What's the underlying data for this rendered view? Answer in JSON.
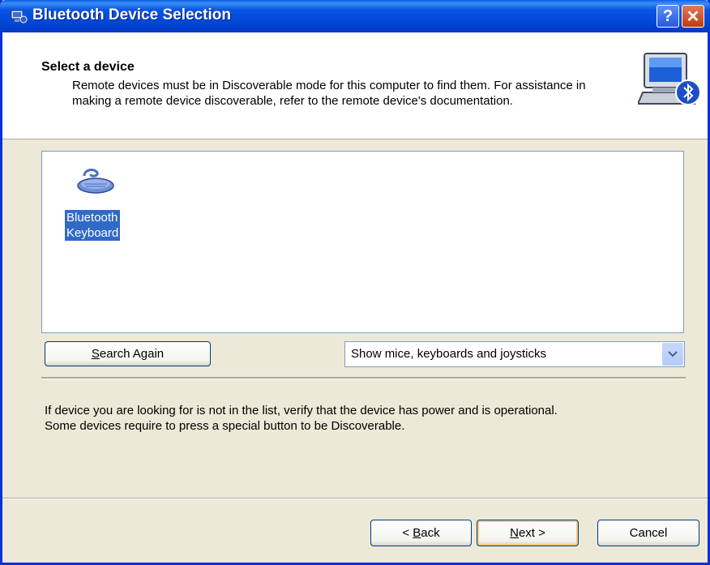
{
  "window": {
    "title": "Bluetooth Device Selection",
    "help_label": "?",
    "close_label": "✕"
  },
  "header": {
    "title": "Select a device",
    "description": "Remote devices must be in Discoverable mode for this computer to find them. For assistance in making a remote device discoverable, refer to the remote device's documentation."
  },
  "device_list": {
    "items": [
      {
        "label_line1": "Bluetooth",
        "label_line2": "Keyboard",
        "icon": "keyboard-icon",
        "selected": true
      }
    ]
  },
  "controls": {
    "search_again_prefix": "",
    "search_again_key": "S",
    "search_again_rest": "earch Again",
    "filter_value": "Show mice, keyboards and joysticks"
  },
  "info": {
    "line1": "If device you are looking for is not in the list, verify that the device has power and is operational.",
    "line2": "Some devices require to press a special button to be Discoverable."
  },
  "footer": {
    "back_prefix": "< ",
    "back_key": "B",
    "back_rest": "ack",
    "next_key": "N",
    "next_rest": "ext >",
    "cancel_label": "Cancel"
  },
  "colors": {
    "titlebar": "#0a55e4",
    "selection": "#316ac5",
    "dialog_bg": "#ece9d8"
  }
}
